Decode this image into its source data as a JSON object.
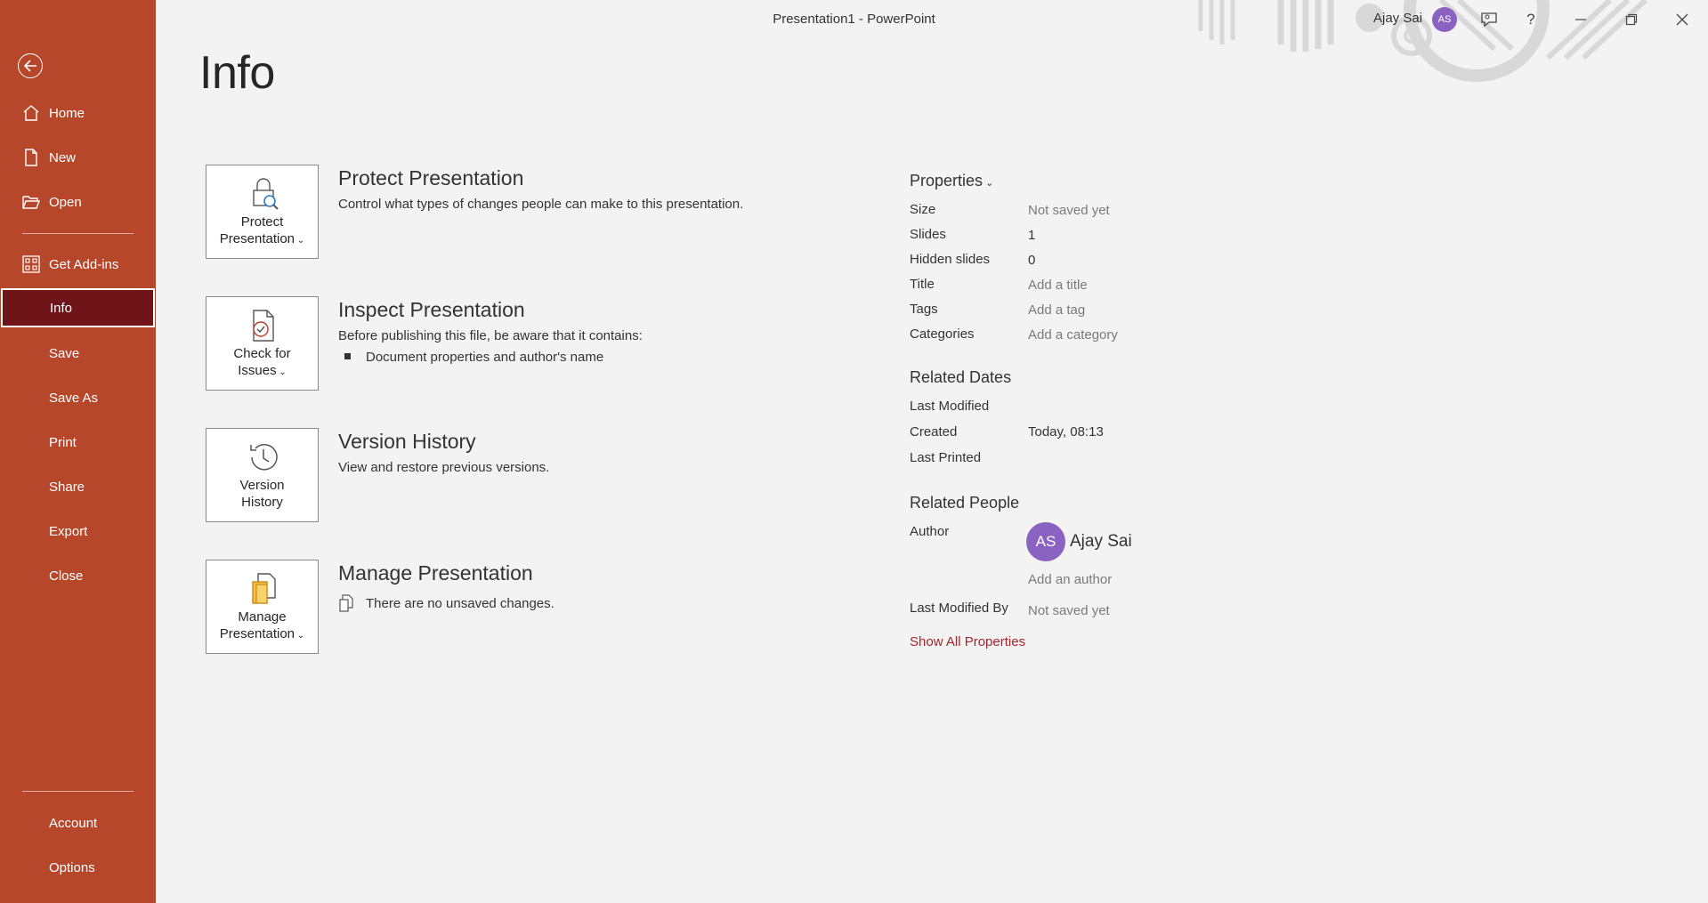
{
  "window": {
    "title": "Presentation1  -  PowerPoint",
    "user_name": "Ajay Sai",
    "user_initials": "AS",
    "accent_color": "#b7472a",
    "selected_color": "#6f1419",
    "controls": [
      "comment-icon",
      "help-icon",
      "minimize-icon",
      "restore-icon",
      "close-icon"
    ]
  },
  "sidebar": {
    "back_icon": "back-arrow-icon",
    "items": [
      {
        "label": "Home",
        "icon": "home-icon"
      },
      {
        "label": "New",
        "icon": "new-document-icon"
      },
      {
        "label": "Open",
        "icon": "folder-open-icon"
      },
      {
        "label": "Get Add-ins",
        "icon": "add-ins-grid-icon"
      },
      {
        "label": "Info",
        "selected": true
      },
      {
        "label": "Save"
      },
      {
        "label": "Save As"
      },
      {
        "label": "Print"
      },
      {
        "label": "Share"
      },
      {
        "label": "Export"
      },
      {
        "label": "Close"
      }
    ],
    "bottom_items": [
      {
        "label": "Account"
      },
      {
        "label": "Options"
      }
    ]
  },
  "main": {
    "title": "Info",
    "sections": [
      {
        "card_label_1": "Protect",
        "card_label_2": "Presentation",
        "title": "Protect Presentation",
        "description": "Control what types of changes people can make to this presentation.",
        "icon": "lock-magnifier-icon"
      },
      {
        "card_label_1": "Check for",
        "card_label_2": "Issues",
        "title": "Inspect Presentation",
        "description": "Before publishing this file, be aware that it contains:",
        "bullets": [
          "Document properties and author's name"
        ],
        "icon": "document-check-icon"
      },
      {
        "card_label_1": "Version",
        "card_label_2": "History",
        "title": "Version History",
        "description": "View and restore previous versions.",
        "icon": "history-clock-icon"
      },
      {
        "card_label_1": "Manage",
        "card_label_2": "Presentation",
        "title": "Manage Presentation",
        "description": "There are no unsaved changes.",
        "icon": "manage-documents-icon"
      }
    ]
  },
  "properties": {
    "heading": "Properties",
    "rows": [
      {
        "label": "Size",
        "value": "Not saved yet"
      },
      {
        "label": "Slides",
        "value": "1"
      },
      {
        "label": "Hidden slides",
        "value": "0"
      },
      {
        "label": "Title",
        "value": "Add a title"
      },
      {
        "label": "Tags",
        "value": "Add a tag"
      },
      {
        "label": "Categories",
        "value": "Add a category"
      }
    ],
    "related_dates": {
      "heading": "Related Dates",
      "rows": [
        {
          "label": "Last Modified",
          "value": ""
        },
        {
          "label": "Created",
          "value": "Today, 08:13"
        },
        {
          "label": "Last Printed",
          "value": ""
        }
      ]
    },
    "related_people": {
      "heading": "Related People",
      "author_label": "Author",
      "author_initials": "AS",
      "author_name": "Ajay Sai",
      "add_author": "Add an author",
      "last_modified_by_label": "Last Modified By",
      "last_modified_by_value": "Not saved yet"
    },
    "show_all": "Show All Properties"
  }
}
